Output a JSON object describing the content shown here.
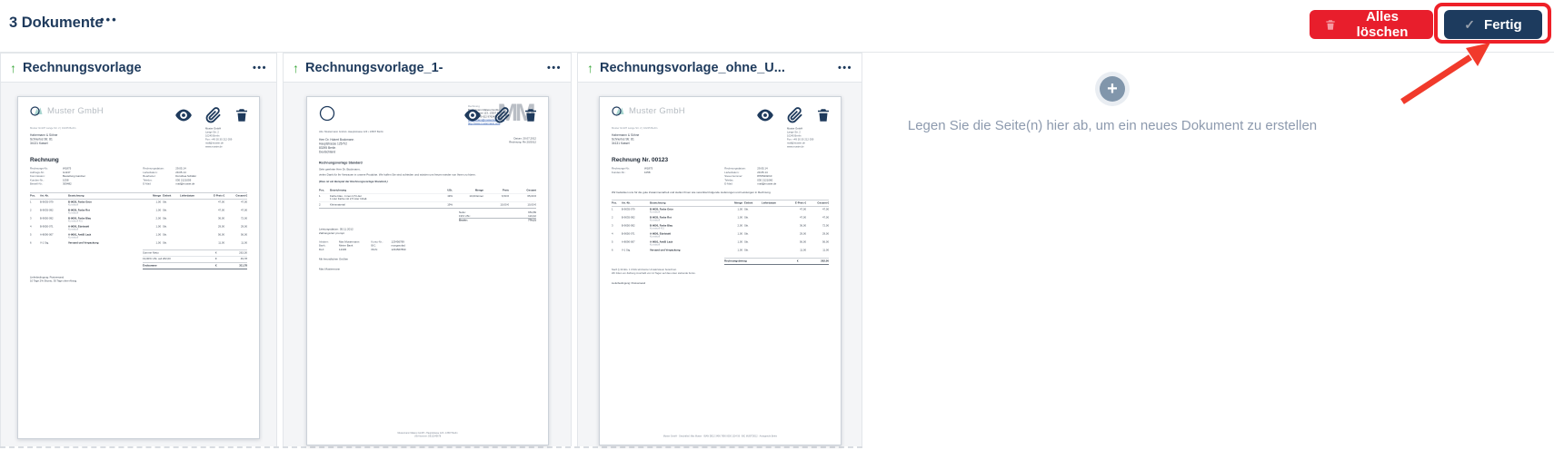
{
  "header": {
    "title": "3 Dokumente",
    "delete_all_label": "Alles löschen",
    "done_label": "Fertig"
  },
  "icons": {
    "ellipsis": "•••",
    "upload_arrow": "↑",
    "plus": "+",
    "check": "✓"
  },
  "colors": {
    "navy": "#1e3a5c",
    "red": "#e81e2c",
    "green": "#3aa83a",
    "annotation_red": "#ee2028",
    "gray_hint": "#8d9aae",
    "link_blue": "#2d5bb0",
    "logo_teal": "#a9d6d0"
  },
  "dropzone": {
    "hint": "Legen Sie die Seite(n) hier ab, um ein neues Dokument zu erstellen"
  },
  "cards": [
    {
      "title": "Rechnungsvorlage",
      "doc": {
        "logo_text": "Muster GmbH",
        "sender_line": "Muster GmbH Lange Str. 2 | 10245 Berlin",
        "recipient": [
          "Habermann & Söhne",
          "Schnurlos Str. 81",
          "34131 Kassel"
        ],
        "contact": [
          "Muster GmbH",
          "Lange Str. 2",
          "10245 Berlin",
          "Fon: +49 30 30 212 059",
          "mail@muster.de",
          "www.muster.de"
        ],
        "title": "Rechnung",
        "meta_left": [
          {
            "k": "Rechnungs-Nr.:",
            "v": "W1875"
          },
          {
            "k": "Auftrags-Nr.:",
            "v": "G1137"
          },
          {
            "k": "Kommission:",
            "v": "Bestellung Gardner"
          },
          {
            "k": "Kunden-Nr.:",
            "v": "1058"
          },
          {
            "k": "Bestell-Nr.:",
            "v": "309482"
          }
        ],
        "meta_right": [
          {
            "k": "Rechnungsdatum:",
            "v": "29.05.14"
          },
          {
            "k": "Lieferdatum:",
            "v": "29.05.14"
          },
          {
            "k": "Bearbeiter:",
            "v": "Dorothea Schäfer"
          },
          {
            "k": "Telefon:",
            "v": "030 2121059"
          },
          {
            "k": "E-Mail:",
            "v": "mail@muster.de"
          }
        ],
        "table_headers": {
          "pos": "Pos.",
          "art": "Art.-Nr.",
          "name": "Bezeichnung",
          "menge": "Menge",
          "einheit": "Einheit",
          "lieferdatum": "Lieferdatum",
          "preis": "E-Preis €",
          "gesamt": "Gesamt €"
        },
        "rows": [
          {
            "pos": "1",
            "art": "B-9035-079",
            "name": "B-9035, Farbe Grün",
            "sub": "Kunststoff",
            "menge": "1,00",
            "einheit": "Stk.",
            "preis": "47,00",
            "gesamt": "47,00"
          },
          {
            "pos": "2",
            "art": "B-9035-092",
            "name": "B-9035, Farbe Rot",
            "sub": "Kunststoff",
            "menge": "1,00",
            "einheit": "Stk.",
            "preis": "47,00",
            "gesamt": "47,00"
          },
          {
            "pos": "3",
            "art": "B-9050-092",
            "name": "B-9050, Farbe Blau",
            "sub": "Kunststoff 401",
            "menge": "2,00",
            "einheit": "Stk.",
            "preis": "36,00",
            "gesamt": "72,00"
          },
          {
            "pos": "4",
            "art": "B-9050-071",
            "name": "A-9050, Edelstahl",
            "sub": "Kunststoff",
            "menge": "1,00",
            "einheit": "Stk.",
            "preis": "29,00",
            "gesamt": "29,00"
          },
          {
            "pos": "5",
            "art": "A-8090-007",
            "name": "A-9091, AntiB Lack",
            "sub": "Kunststoff",
            "menge": "1,00",
            "einheit": "Stk.",
            "preis": "56,00",
            "gesamt": "56,00"
          },
          {
            "pos": "6",
            "art": "V-1 Stg.",
            "name": "Versand und Verpackung",
            "sub": "",
            "menge": "1,00",
            "einheit": "Stk.",
            "preis": "11,00",
            "gesamt": "11,00"
          }
        ],
        "totals": [
          {
            "label": "Summe Netto",
            "cur": "€",
            "value": "262,00"
          },
          {
            "label": "19,00% USt. auf 262,00",
            "cur": "€",
            "value": "49,78"
          },
          {
            "label": "Endsumme",
            "cur": "€",
            "value": "311,78"
          }
        ],
        "terms": [
          "Lieferbedingung: Postversand",
          "10 Tage 2% Skonto, 30 Tage ohne Abzug"
        ]
      }
    },
    {
      "title": "Rechnungsvorlage_1-",
      "doc": {
        "mm_logo": "MM",
        "header_right_label": "Rechnung",
        "header_right": [
          "Mustermann Malerei GmbH,",
          "Hauptstrasse 123, 13507 Berlin",
          "Tel/Fax: +49 622 97654321"
        ],
        "links": [
          "mustermann@mustermann.com",
          "http://www.mustermann.com"
        ],
        "abs_line": "Abs: Mustermann GmbH • Hauptstrasse 123 • 13507 Berlin",
        "recipient": [
          "Herr Dr. Hubert Bockmann",
          "Hauptstrasse 125/7/2",
          "83295 Berlin",
          "Deutschland"
        ],
        "date_lines": [
          "Datum: 20.07.2012",
          "Rechnung: Re 20/2012"
        ],
        "subject": "Rechnungsvorlage Standard",
        "greeting": "Sehr geehrter Herr Dr. Bockmann,",
        "body": "vielen Dank für Ihr Vertrauen in unsere Produkte. Wir hoffen Sie sind zufrieden und würden uns freuen wieder von Ihnen zu hören.",
        "note": "(Dies ist ein Beispiel der Rechnungsvorlage Standard.)",
        "table_headers": {
          "pos": "Pos.",
          "name": "Bezeichnung",
          "ust": "USt.",
          "menge": "Menge",
          "preis": "Preis",
          "gesamt": "Gesamt"
        },
        "rows": [
          {
            "pos": "1",
            "name": "Farbe blau - Innen 2,5 Liter",
            "sub": "1 Liter Farbe mit 2,5 Liter Inhalt.",
            "ust": "19%",
            "menge": "10,00 Eimer",
            "preis": "6,50 €",
            "gesamt": "65,00 €"
          },
          {
            "pos": "2",
            "name": "Kleinmaterial",
            "sub": "",
            "ust": "19%",
            "menge": "",
            "preis": "10,00 €",
            "gesamt": "10,00 €"
          }
        ],
        "totals": [
          {
            "label": "Netto:",
            "value": "654,89"
          },
          {
            "label": "19% USt.:",
            "value": "124,42"
          },
          {
            "label": "Brutto:",
            "value": "779,31"
          }
        ],
        "leistung": "Leistungsdatum: 05.11.2012",
        "zahlung": "Zahlungsziel: prompt",
        "bank_left": [
          {
            "k": "Inhaber:",
            "v": "Max Mustermann"
          },
          {
            "k": "Bank:",
            "v": "Meine Bank"
          },
          {
            "k": "BLZ:",
            "v": "12345"
          }
        ],
        "bank_right": [
          {
            "k": "Konto-Nr.:",
            "v": "123456789"
          },
          {
            "k": "BIC:",
            "v": "musgsxxlad"
          },
          {
            "k": "IBAN:",
            "v": "1234567890"
          }
        ],
        "closing": "Mit freundlichen Grüßen",
        "signature": "Max Mustermann",
        "footer": [
          "Mustermann Malerei GmbH • Hauptstrasse 123 • 13507 Berlin",
          "USt-Nummer: DE12345678"
        ]
      }
    },
    {
      "title": "Rechnungsvorlage_ohne_U...",
      "doc": {
        "logo_text": "Muster GmbH",
        "sender_line": "Muster GmbH Lange Str. 2 | 10245 Berlin",
        "recipient": [
          "Habermann & Söhne",
          "Schnurlos Str. 81",
          "34131 Kassel"
        ],
        "contact": [
          "Muster GmbH",
          "Lange Str. 2",
          "10245 Berlin",
          "Fon: +49 30 30 212 059",
          "mail@muster.de",
          "www.muster.de"
        ],
        "title": "Rechnung Nr. 00123",
        "meta_left": [
          {
            "k": "Rechnungs-Nr.:",
            "v": "W1875"
          },
          {
            "k": "Kunden-Nr.:",
            "v": "1058"
          }
        ],
        "meta_right": [
          {
            "k": "Rechnungsdatum:",
            "v": "29.05.14"
          },
          {
            "k": "Lieferdatum:",
            "v": "29.05.14"
          },
          {
            "k": "Steuernummer:",
            "v": "876/5432/10"
          },
          {
            "k": "Telefax:",
            "v": "030 2121060"
          },
          {
            "k": "E-Mail:",
            "v": "mail@muster.de"
          }
        ],
        "intro": "Wir bedanken uns für die gute Zusammenarbeit und stellen Ihnen wie vereinbart folgende Lieferungen und Leistungen in Rechnung.",
        "table_headers": {
          "pos": "Pos.",
          "art": "Art.-Nr.",
          "name": "Bezeichnung",
          "menge": "Menge",
          "einheit": "Einheit",
          "lieferdatum": "Lieferdatum",
          "preis": "E-Preis €",
          "gesamt": "Gesamt €"
        },
        "rows": [
          {
            "pos": "1",
            "art": "B-9035-079",
            "name": "B-9035, Farbe Grün",
            "sub": "Kunststoff",
            "menge": "1,00",
            "einheit": "Stk.",
            "preis": "47,00",
            "gesamt": "47,00"
          },
          {
            "pos": "2",
            "art": "B-9035-092",
            "name": "B-9035, Farbe Rot",
            "sub": "Kunststoff",
            "menge": "1,00",
            "einheit": "Stk.",
            "preis": "47,00",
            "gesamt": "47,00"
          },
          {
            "pos": "3",
            "art": "B-9050-092",
            "name": "B-9050, Farbe Blau",
            "sub": "Kunststoff 401",
            "menge": "2,00",
            "einheit": "Stk.",
            "preis": "36,00",
            "gesamt": "72,00"
          },
          {
            "pos": "4",
            "art": "B-9050-071",
            "name": "A-9050, Edelstahl",
            "sub": "Kunststoff",
            "menge": "1,00",
            "einheit": "Stk.",
            "preis": "29,00",
            "gesamt": "29,00"
          },
          {
            "pos": "5",
            "art": "A-8090-007",
            "name": "A-9091, AntiB Lack",
            "sub": "Kunststoff",
            "menge": "1,00",
            "einheit": "Stk.",
            "preis": "56,00",
            "gesamt": "56,00"
          },
          {
            "pos": "6",
            "art": "V-1 Stg.",
            "name": "Versand und Verpackung",
            "sub": "",
            "menge": "1,00",
            "einheit": "Stk.",
            "preis": "11,00",
            "gesamt": "11,00"
          }
        ],
        "total": {
          "label": "Rechnungsbetrag",
          "cur": "€",
          "value": "262,00"
        },
        "note_lines": [
          "Nach § 19 Abs. 1 UStG wird keine Umsatzsteuer berechnet.",
          "Wir bitten um Zahlung innerhalb von 14 Tagen auf das unten stehende Konto."
        ],
        "terms": [
          "Lieferbedingung: Postversand"
        ],
        "footer_line": "Muster GmbH · Geschäftsf. Max Muster · IBAN DE12 3456 7890 0000 1234 56 · BIC MUSTDE12 · Amtsgericht Berlin"
      }
    }
  ]
}
